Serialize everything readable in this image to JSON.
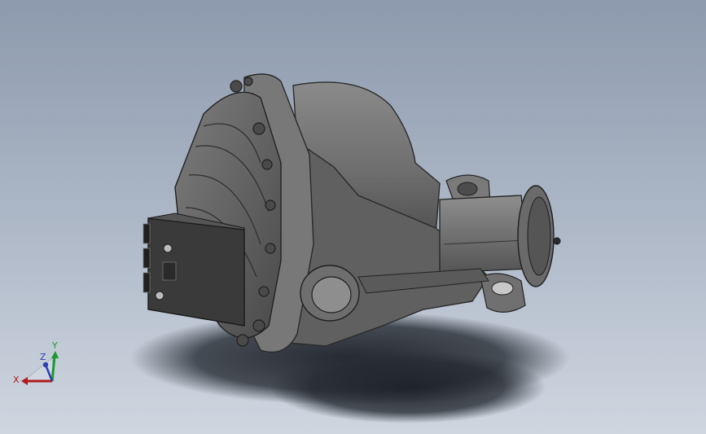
{
  "triad": {
    "x_label": "X",
    "y_label": "Y",
    "z_label": "Z"
  },
  "colors": {
    "background_top": "#8d9aad",
    "background_bottom": "#cfd6e0",
    "part_body": "#6b6b6b",
    "part_dark": "#3e3e3e",
    "x_axis": "#b01a1a",
    "y_axis": "#1c9a2c",
    "z_axis": "#2b3fb3"
  }
}
